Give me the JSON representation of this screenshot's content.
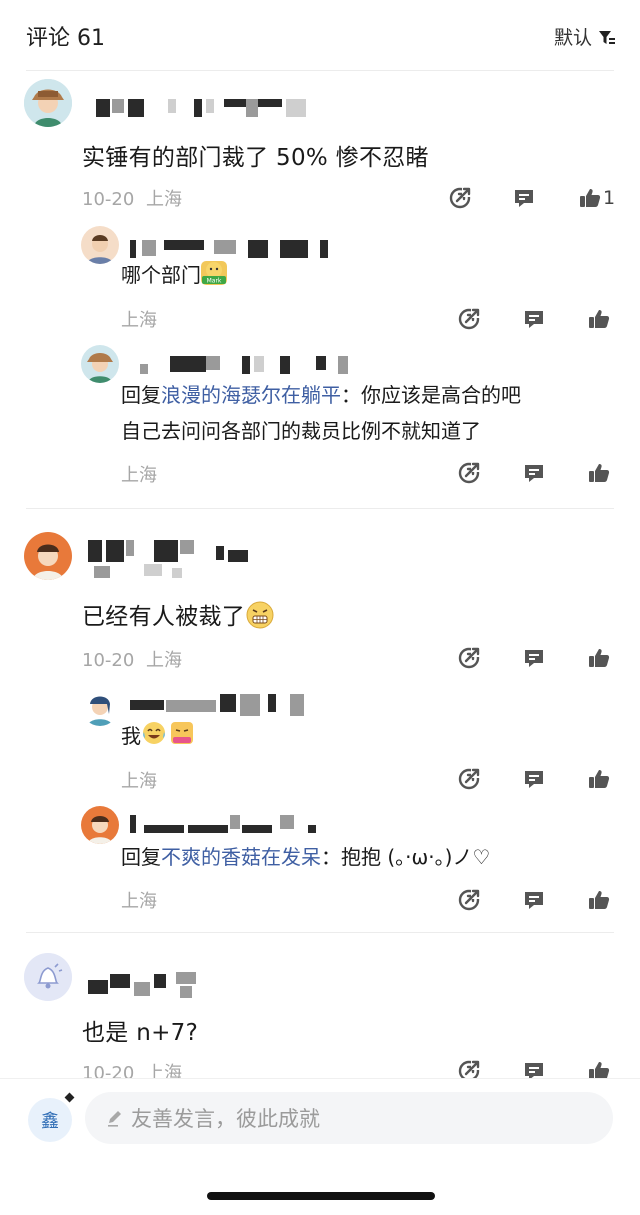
{
  "header": {
    "title": "评论 61",
    "sort_label": "默认"
  },
  "comments": [
    {
      "text": "实锤有的部门裁了 50%  惨不忍睹",
      "date": "10-20",
      "location": "上海",
      "likes": "1",
      "replies": [
        {
          "text": "哪个部门",
          "location": "上海"
        },
        {
          "prefix": "回复",
          "reply_to": "浪漫的海瑟尔在躺平",
          "colon": "：",
          "text_line1": "你应该是高合的吧",
          "text_line2": "自己去问问各部门的裁员比例不就知道了",
          "location": "上海"
        }
      ]
    },
    {
      "text": "已经有人被裁了",
      "date": "10-20",
      "location": "上海",
      "replies": [
        {
          "text": "我",
          "location": "上海"
        },
        {
          "prefix": "回复",
          "reply_to": "不爽的香菇在发呆",
          "colon": "：",
          "text_line1": "抱抱 (。·ω·。)ノ♡",
          "location": "上海"
        }
      ]
    },
    {
      "text": "也是 n+7?",
      "date": "10-20",
      "location": "上海"
    }
  ],
  "composer": {
    "user_badge": "鑫",
    "placeholder": "友善发言，彼此成就"
  },
  "icons": {
    "share": "share-icon",
    "reply": "reply-icon",
    "like": "thumbs-up-icon",
    "sort": "filter-sort-icon",
    "compose": "pencil-icon"
  },
  "colors": {
    "link": "#3f5fa3",
    "meta": "#a6a6a6",
    "text": "#1a1a1a"
  }
}
